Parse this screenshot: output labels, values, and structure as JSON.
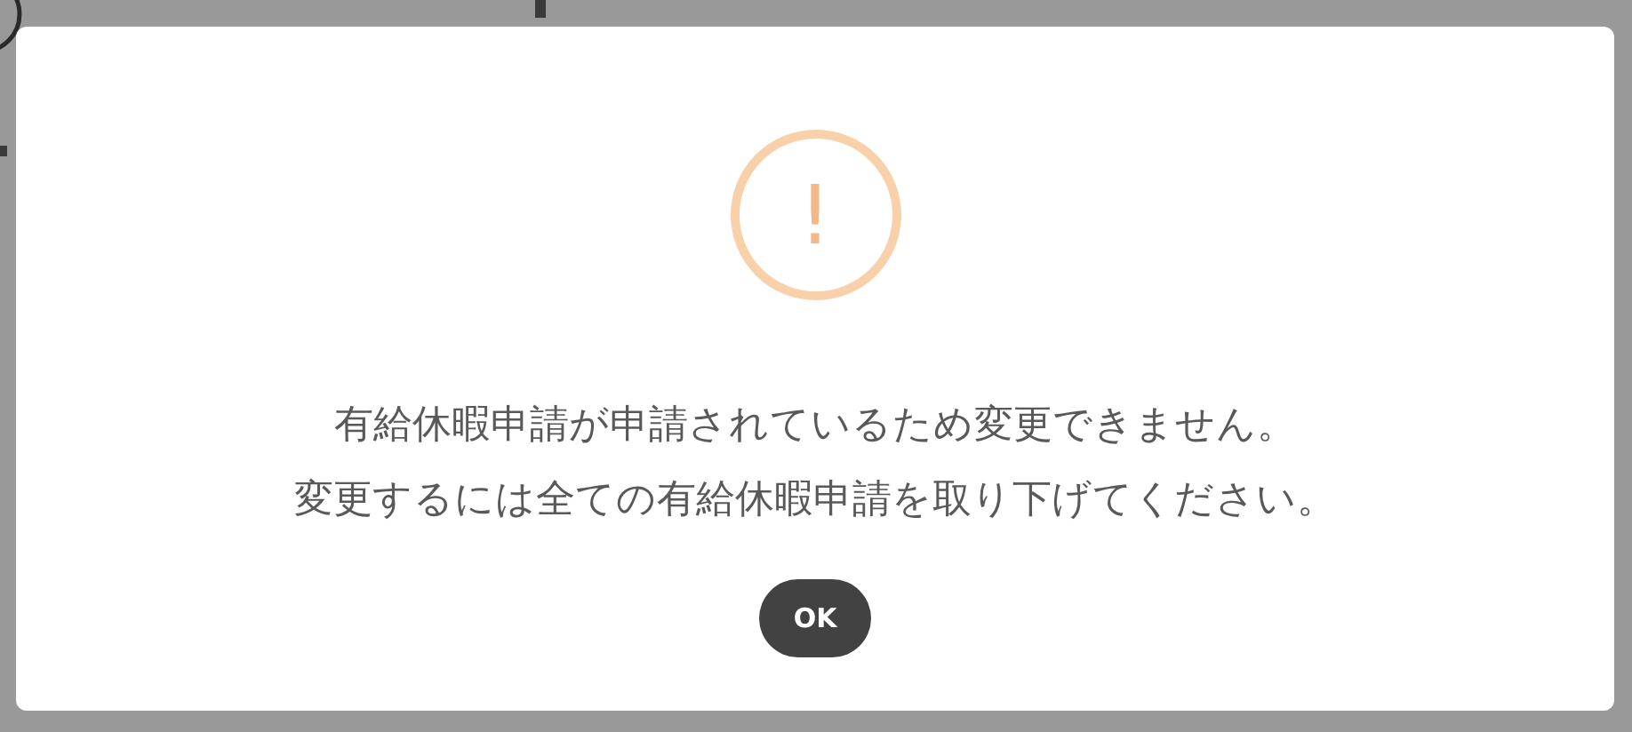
{
  "dialog": {
    "icon": "!",
    "message": [
      "有給休暇申請が申請されているため変更できません。",
      "変更するには全ての有給休暇申請を取り下げてください。"
    ],
    "buttons": [
      "OK"
    ]
  }
}
